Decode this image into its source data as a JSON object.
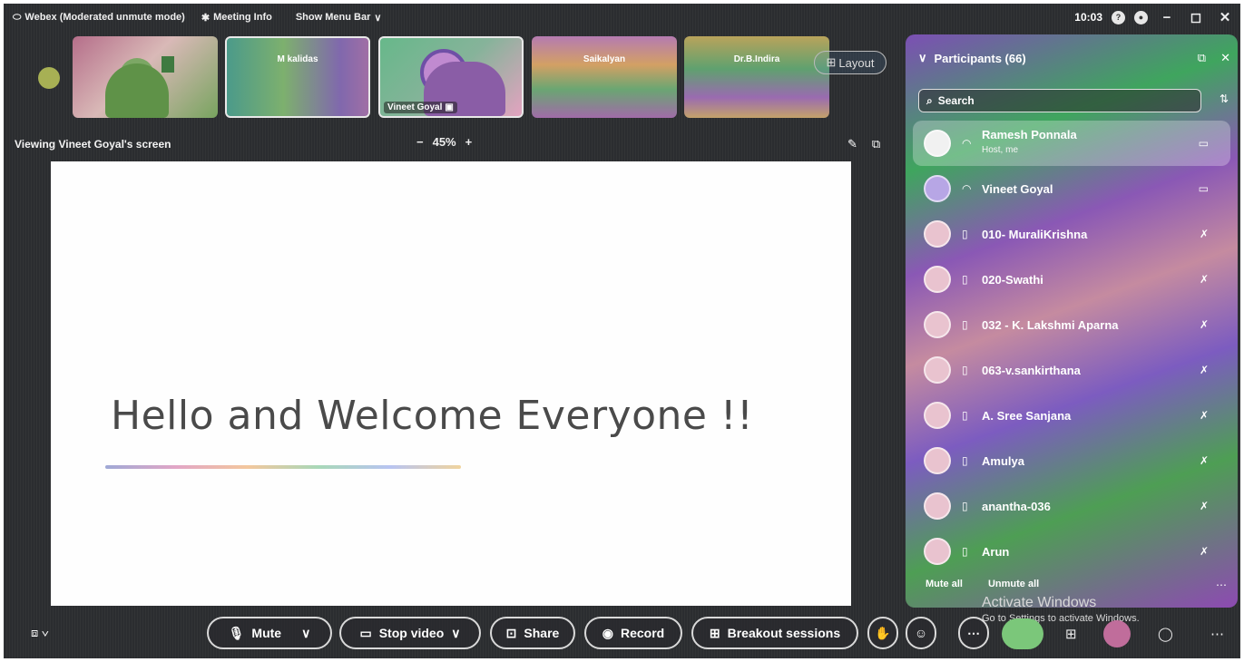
{
  "topbar": {
    "app_title": "Webex (Moderated unmute mode)",
    "meeting_info": "Meeting Info",
    "show_menu_bar": "Show Menu Bar",
    "time": "10:03"
  },
  "thumbnails": [
    {
      "label": ""
    },
    {
      "label": "M kalidas"
    },
    {
      "label": "Vineet Goyal"
    },
    {
      "label": "Saikalyan"
    },
    {
      "label": "Dr.B.Indira"
    }
  ],
  "layout_label": "Layout",
  "viewing_label": "Viewing Vineet Goyal's screen",
  "zoom_level": "45%",
  "slide": {
    "title": "Hello and Welcome Everyone !!"
  },
  "participants": {
    "header": "Participants (66)",
    "search_placeholder": "Search",
    "list": [
      {
        "name": "Ramesh Ponnala",
        "sub": "Host, me"
      },
      {
        "name": "Vineet Goyal"
      },
      {
        "name": "010- MuraliKrishna"
      },
      {
        "name": "020-Swathi"
      },
      {
        "name": "032 - K. Lakshmi Aparna"
      },
      {
        "name": "063-v.sankirthana"
      },
      {
        "name": "A. Sree Sanjana"
      },
      {
        "name": "Amulya"
      },
      {
        "name": "anantha-036"
      },
      {
        "name": "Arun"
      }
    ],
    "mute_all": "Mute all",
    "unmute_all": "Unmute all"
  },
  "watermark": {
    "heading": "Activate Windows",
    "sub": "Go to Settings to activate Windows."
  },
  "controls": {
    "mute": "Mute",
    "stop_video": "Stop video",
    "share": "Share",
    "record": "Record",
    "breakout": "Breakout sessions"
  }
}
